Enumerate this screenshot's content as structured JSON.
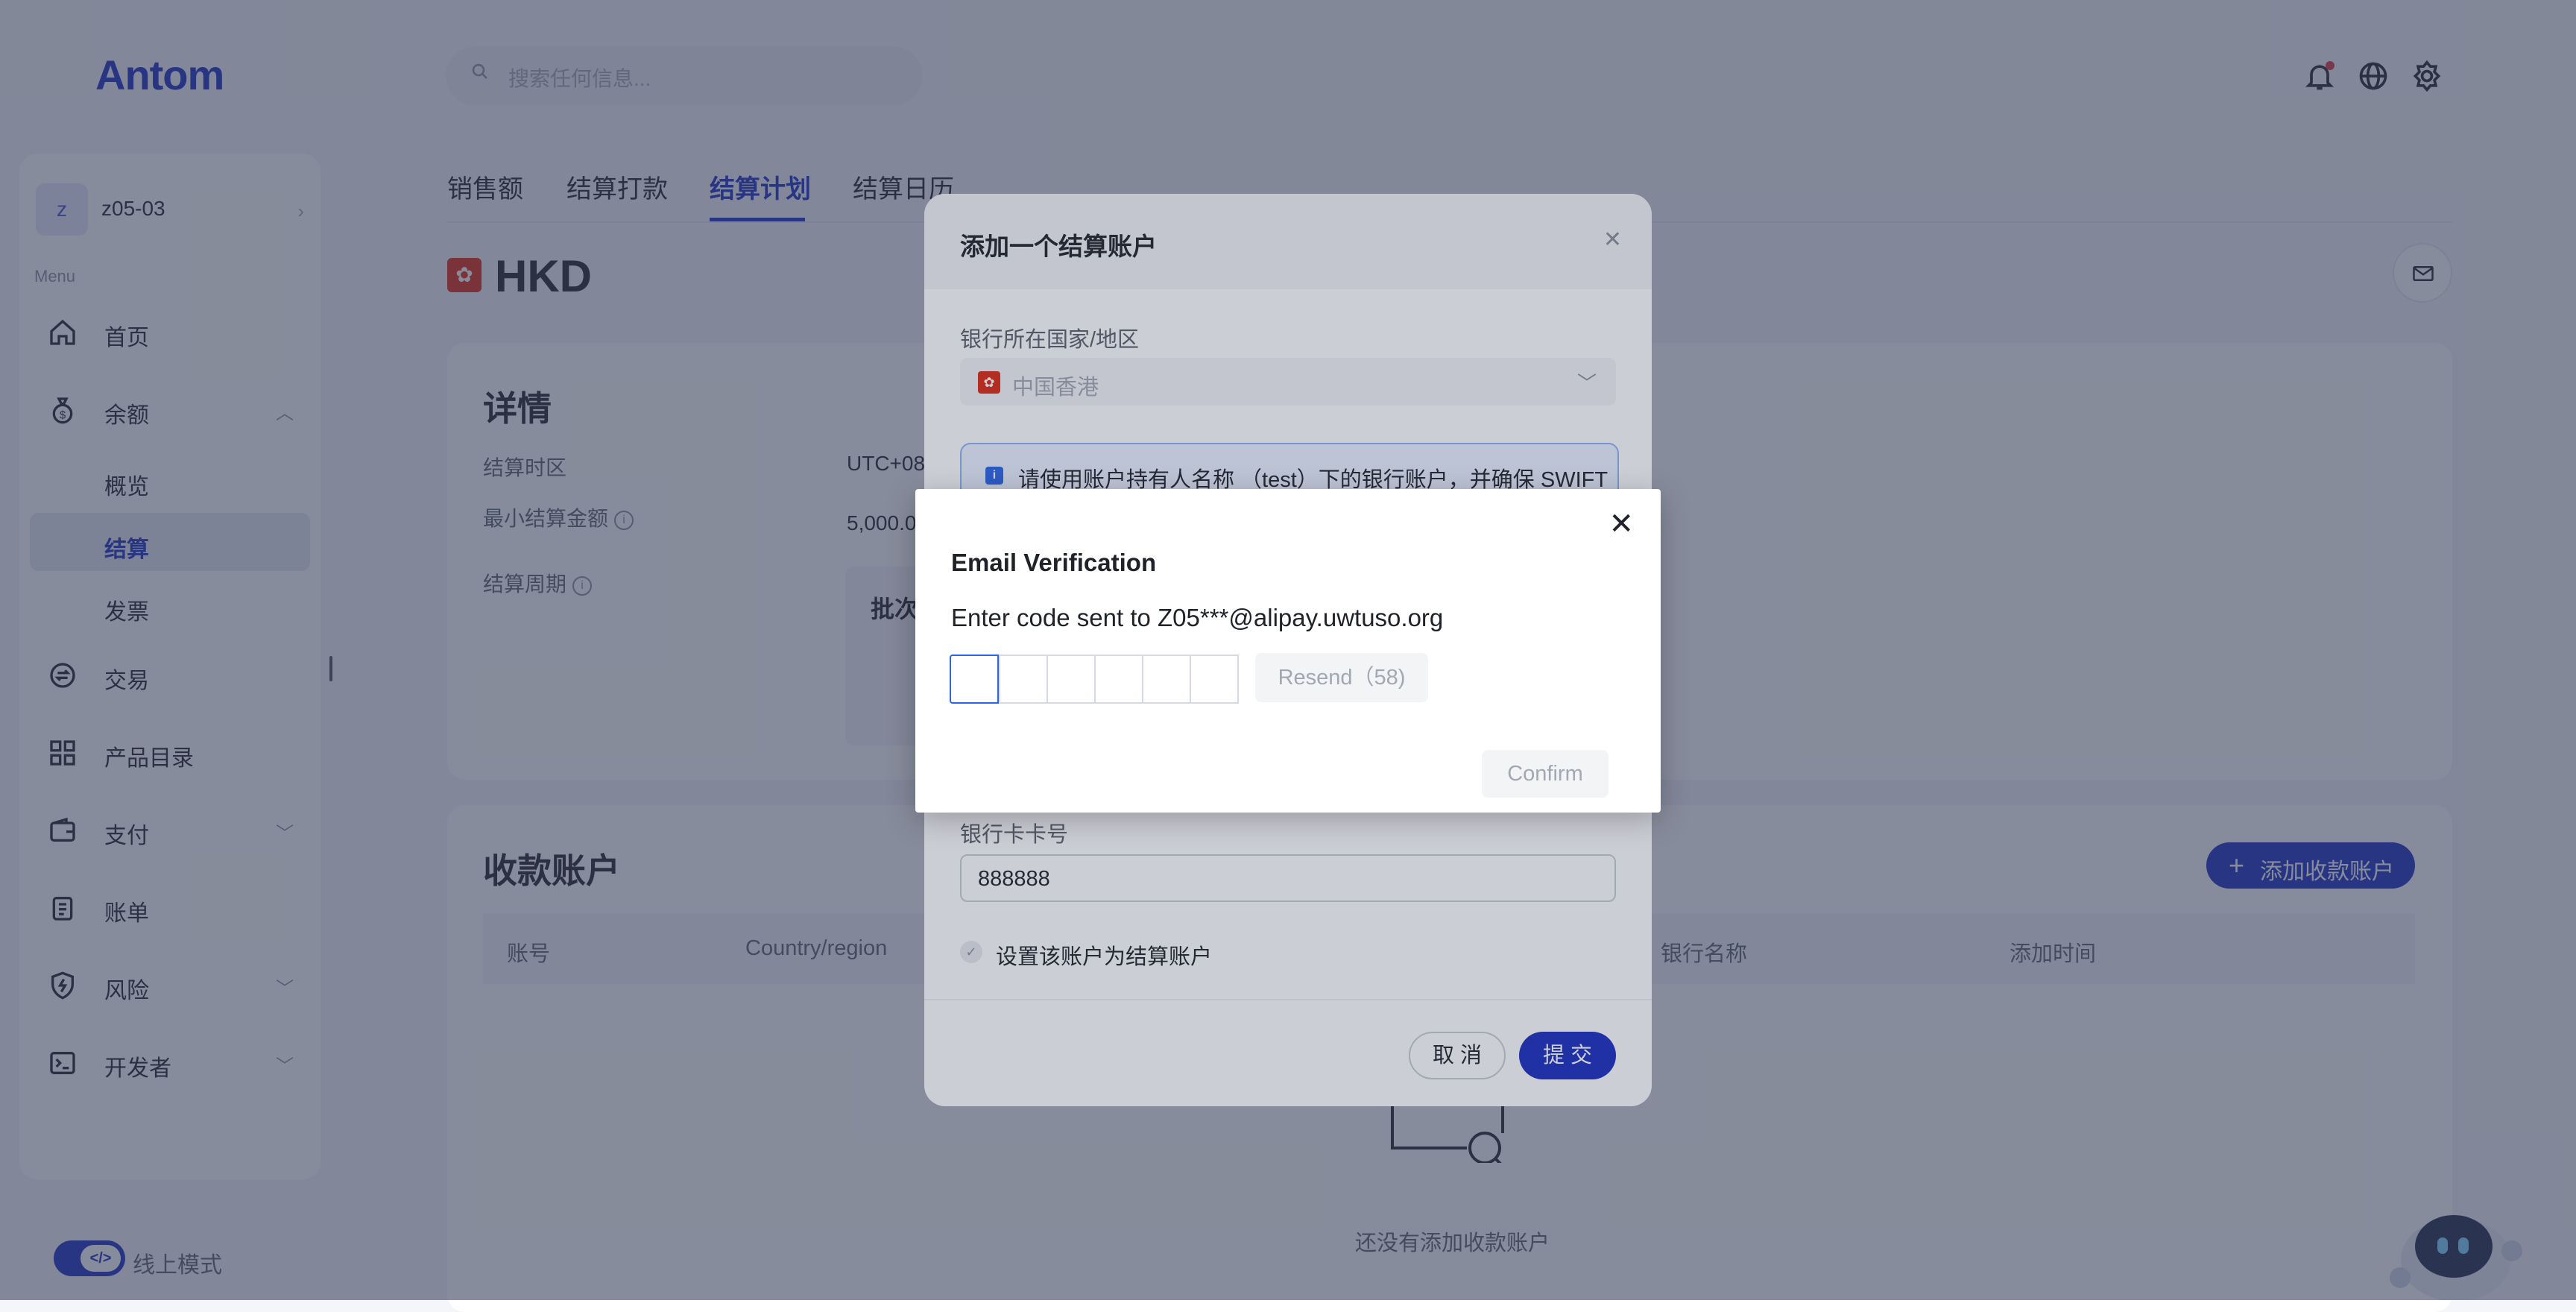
{
  "app": {
    "logo": "Antom"
  },
  "search": {
    "placeholder": "搜索任何信息..."
  },
  "account": {
    "avatar_letter": "z",
    "name": "z05-03"
  },
  "sidebar": {
    "menu_label": "Menu",
    "items": [
      {
        "label": "首页"
      },
      {
        "label": "余额"
      },
      {
        "label": "交易"
      },
      {
        "label": "产品目录"
      },
      {
        "label": "支付"
      },
      {
        "label": "账单"
      },
      {
        "label": "风险"
      },
      {
        "label": "开发者"
      }
    ],
    "balance_sub": [
      {
        "label": "概览"
      },
      {
        "label": "结算",
        "active": true
      },
      {
        "label": "发票"
      }
    ],
    "mode_label": "线上模式"
  },
  "tabs": [
    {
      "label": "销售额"
    },
    {
      "label": "结算打款"
    },
    {
      "label": "结算计划",
      "active": true
    },
    {
      "label": "结算日历"
    }
  ],
  "currency": {
    "code": "HKD",
    "flag_glyph": "✿"
  },
  "details": {
    "title": "详情",
    "timezone_label": "结算时区",
    "timezone_value": "UTC+08",
    "min_amount_label": "最小结算金额",
    "min_amount_value": "5,000.0",
    "cycle_label": "结算周期",
    "cycle_box_title": "批次"
  },
  "accounts": {
    "title": "收款账户",
    "add_button": "添加收款账户",
    "columns": [
      "账号",
      "Country/region",
      "银行名称",
      "添加时间"
    ],
    "empty_text": "还没有添加收款账户"
  },
  "add_dialog": {
    "title": "添加一个结算账户",
    "country_label": "银行所在国家/地区",
    "country_value": "中国香港",
    "notice": "请使用账户持有人名称 （test）下的银行账户，并确保 SWIFT",
    "card_label": "银行卡卡号",
    "card_value": "888888",
    "set_default_label": "设置该账户为结算账户",
    "cancel": "取 消",
    "submit": "提 交"
  },
  "email_dialog": {
    "title": "Email Verification",
    "subtitle": "Enter code sent to Z05***@alipay.uwtuso.org",
    "code_length": 6,
    "resend": "Resend（58)",
    "confirm": "Confirm"
  },
  "colors": {
    "brand": "#1a2dbf",
    "focus": "#2b66e8",
    "danger": "#e0343c",
    "hk_flag": "#de2910"
  }
}
